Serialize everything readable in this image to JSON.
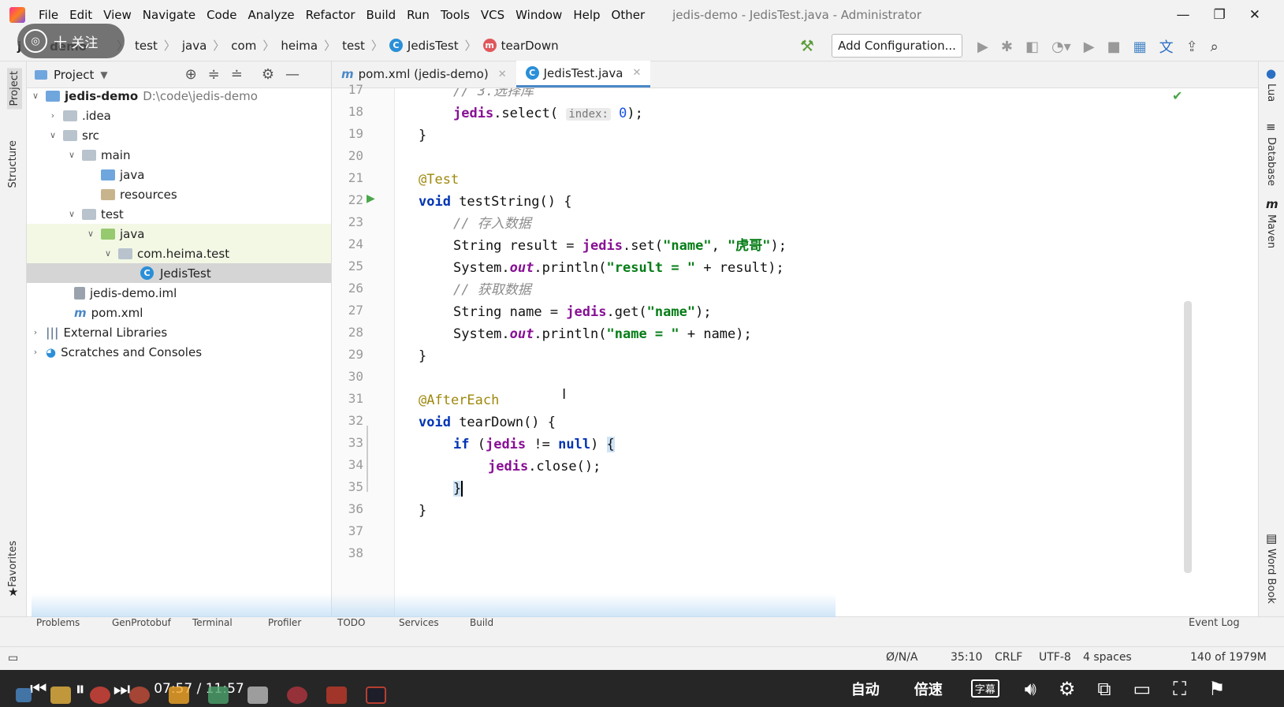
{
  "menu": {
    "items": [
      "File",
      "Edit",
      "View",
      "Navigate",
      "Code",
      "Analyze",
      "Refactor",
      "Build",
      "Run",
      "Tools",
      "VCS",
      "Window",
      "Help",
      "Other"
    ],
    "window_title": "jedis-demo - JedisTest.java - Administrator"
  },
  "window_controls": {
    "minimize": "—",
    "restore": "❐",
    "close": "✕"
  },
  "navbar": {
    "project": "jedis-demo",
    "crumbs": [
      "test",
      "java",
      "com",
      "heima",
      "test",
      "JedisTest",
      "tearDown"
    ],
    "add_configuration": "Add Configuration..."
  },
  "follow_overlay": {
    "label": "十 关注"
  },
  "left_tools": {
    "project": "Project",
    "structure": "Structure",
    "favorites": "Favorites"
  },
  "right_tools": {
    "lua": "Lua",
    "database": "Database",
    "maven": "Maven",
    "wordbook": "Word Book"
  },
  "project_panel": {
    "title": "Project",
    "tree": [
      {
        "label": "jedis-demo",
        "path": "D:\\code\\jedis-demo",
        "type": "module"
      },
      {
        "label": ".idea",
        "type": "folder"
      },
      {
        "label": "src",
        "type": "folder"
      },
      {
        "label": "main",
        "type": "folder"
      },
      {
        "label": "java",
        "type": "source-folder"
      },
      {
        "label": "resources",
        "type": "resources-folder"
      },
      {
        "label": "test",
        "type": "folder"
      },
      {
        "label": "java",
        "type": "test-folder"
      },
      {
        "label": "com.heima.test",
        "type": "package"
      },
      {
        "label": "JedisTest",
        "type": "class"
      },
      {
        "label": "jedis-demo.iml",
        "type": "file"
      },
      {
        "label": "pom.xml",
        "type": "maven"
      },
      {
        "label": "External Libraries",
        "type": "libraries"
      },
      {
        "label": "Scratches and Consoles",
        "type": "scratches"
      }
    ]
  },
  "tabs": [
    {
      "label": "pom.xml (jedis-demo)",
      "active": false
    },
    {
      "label": "JedisTest.java",
      "active": true
    }
  ],
  "editor": {
    "line_numbers": [
      "17",
      "18",
      "19",
      "20",
      "21",
      "22",
      "23",
      "24",
      "25",
      "26",
      "27",
      "28",
      "29",
      "30",
      "31",
      "32",
      "33",
      "34",
      "35",
      "36",
      "37",
      "38"
    ],
    "current_line": "35"
  },
  "bottom_tabs": [
    "Problems",
    "GenProtobuf",
    "Terminal",
    "Profiler",
    "TODO",
    "Services",
    "Build",
    "Event Log"
  ],
  "status": {
    "vcs": "Ø/N/A",
    "position": "35:10",
    "line_sep": "CRLF",
    "encoding": "UTF-8",
    "indent": "4 spaces",
    "memory": "140 of 1979M"
  },
  "video": {
    "time": "07:57 / 11:57",
    "auto": "自动",
    "speed": "倍速",
    "subtitle": "字幕"
  }
}
